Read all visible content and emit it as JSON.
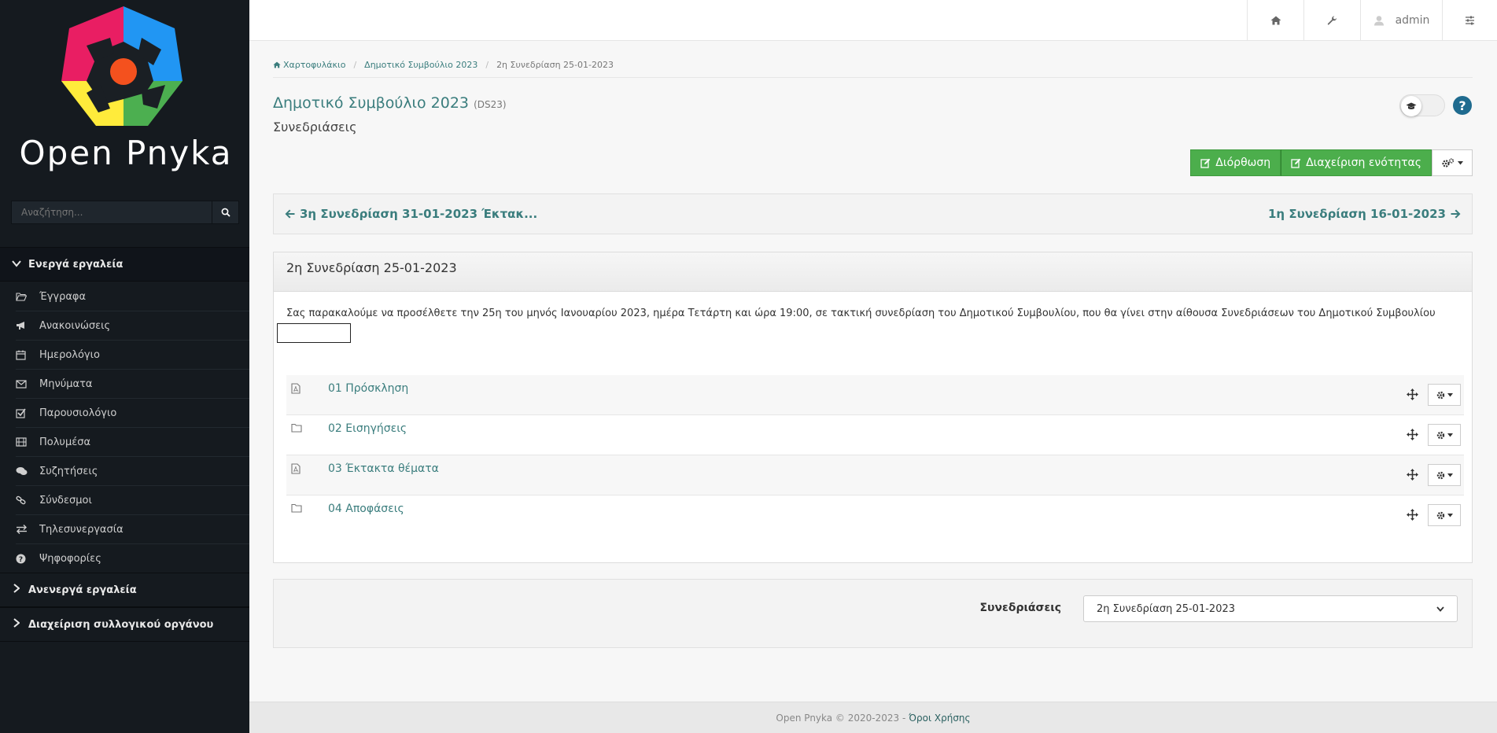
{
  "app": {
    "logo_text": "Open Pnyka"
  },
  "sidebar": {
    "search_placeholder": "Αναζήτηση...",
    "active_group": "Ενεργά εργαλεία",
    "items": [
      {
        "label": "Έγγραφα",
        "icon": "folder-open-icon"
      },
      {
        "label": "Ανακοινώσεις",
        "icon": "bullhorn-icon"
      },
      {
        "label": "Ημερολόγιο",
        "icon": "calendar-icon"
      },
      {
        "label": "Μηνύματα",
        "icon": "envelope-icon"
      },
      {
        "label": "Παρουσιολόγιο",
        "icon": "check-square-icon"
      },
      {
        "label": "Πολυμέσα",
        "icon": "film-icon"
      },
      {
        "label": "Συζητήσεις",
        "icon": "comments-icon"
      },
      {
        "label": "Σύνδεσμοι",
        "icon": "link-icon"
      },
      {
        "label": "Τηλεσυνεργασία",
        "icon": "exchange-icon"
      },
      {
        "label": "Ψηφοφορίες",
        "icon": "question-circle-icon"
      }
    ],
    "inactive_group": "Ανενεργά εργαλεία",
    "admin_group": "Διαχείριση συλλογικού οργάνου"
  },
  "topbar": {
    "user": "admin"
  },
  "breadcrumb": {
    "home": "Χαρτοφυλάκιο",
    "course": "Δημοτικό Συμβούλιο 2023",
    "current": "2η Συνεδρίαση 25-01-2023"
  },
  "page": {
    "title": "Δημοτικό Συμβούλιο 2023",
    "code": "(DS23)",
    "subtitle": "Συνεδριάσεις",
    "help": "?"
  },
  "actions": {
    "edit": "Διόρθωση",
    "manage": "Διαχείριση ενότητας"
  },
  "navigation": {
    "prev": "3η Συνεδρίαση 31-01-2023 Έκτακ...",
    "next": "1η Συνεδρίαση 16-01-2023"
  },
  "session": {
    "title": "2η Συνεδρίαση 25-01-2023",
    "description": "Σας παρακαλούμε να προσέλθετε την 25η του μηνός Ιανουαρίου 2023, ημέρα Τετάρτη και ώρα 19:00, σε τακτική συνεδρίαση του Δημοτικού Συμβουλίου, που θα γίνει στην αίθουσα Συνεδριάσεων του Δημοτικού Συμβουλίου",
    "documents": [
      {
        "label": "01 Πρόσκληση",
        "type": "pdf"
      },
      {
        "label": "02 Εισηγήσεις",
        "type": "folder"
      },
      {
        "label": "03 Έκτακτα θέματα",
        "type": "pdf"
      },
      {
        "label": "04 Αποφάσεις",
        "type": "folder"
      }
    ]
  },
  "filter": {
    "label": "Συνεδριάσεις",
    "selected": "2η Συνεδρίαση 25-01-2023"
  },
  "footer": {
    "text": "Open Pnyka © 2020-2023 -",
    "link": "Όροι Χρήσης"
  }
}
